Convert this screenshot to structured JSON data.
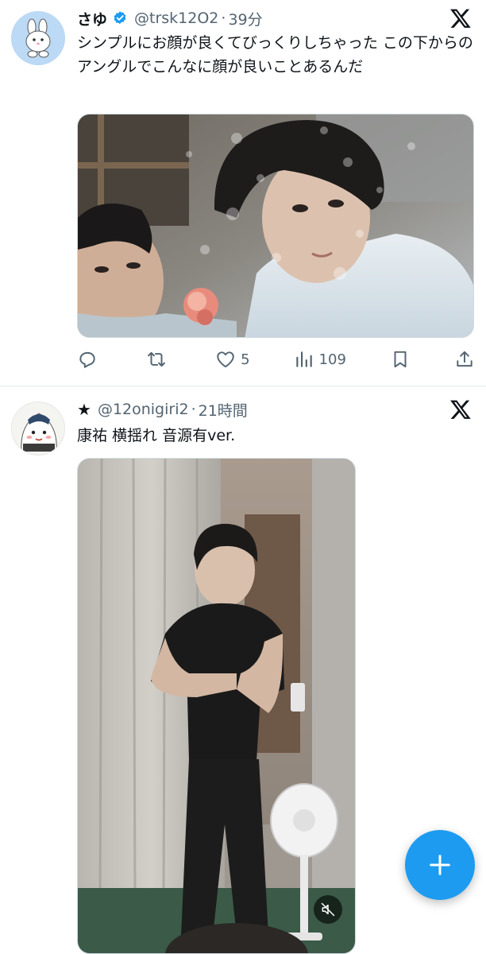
{
  "posts": [
    {
      "display_name": "さゆ",
      "verified": true,
      "handle": "@trsk12O2",
      "separator": "·",
      "time": "39分",
      "text": "シンプルにお顔が良くてびっくりしちゃった この下からのアングルでこんなに顔が良いことあるんだ",
      "avatar_icon": "white-rabbit-avatar-icon",
      "actions": {
        "reply": "",
        "retweet": "",
        "like": "5",
        "views": "109"
      }
    },
    {
      "display_name": "★",
      "handle": "@12onigiri2",
      "separator": "·",
      "time": "21時間",
      "text": "康祐 横揺れ 音源有ver.",
      "avatar_icon": "onigiri-character-avatar-icon",
      "video_muted": true
    }
  ],
  "icons": {
    "x_logo": "x-logo-icon",
    "verified": "verified-badge-icon",
    "reply": "reply-icon",
    "retweet": "retweet-icon",
    "like": "heart-icon",
    "views": "views-bar-chart-icon",
    "bookmark": "bookmark-icon",
    "share": "share-icon",
    "mute": "muted-speaker-icon",
    "compose": "plus-icon"
  },
  "colors": {
    "brand_blue": "#1d9bf0",
    "text_primary": "#0f1419",
    "text_secondary": "#536471"
  }
}
